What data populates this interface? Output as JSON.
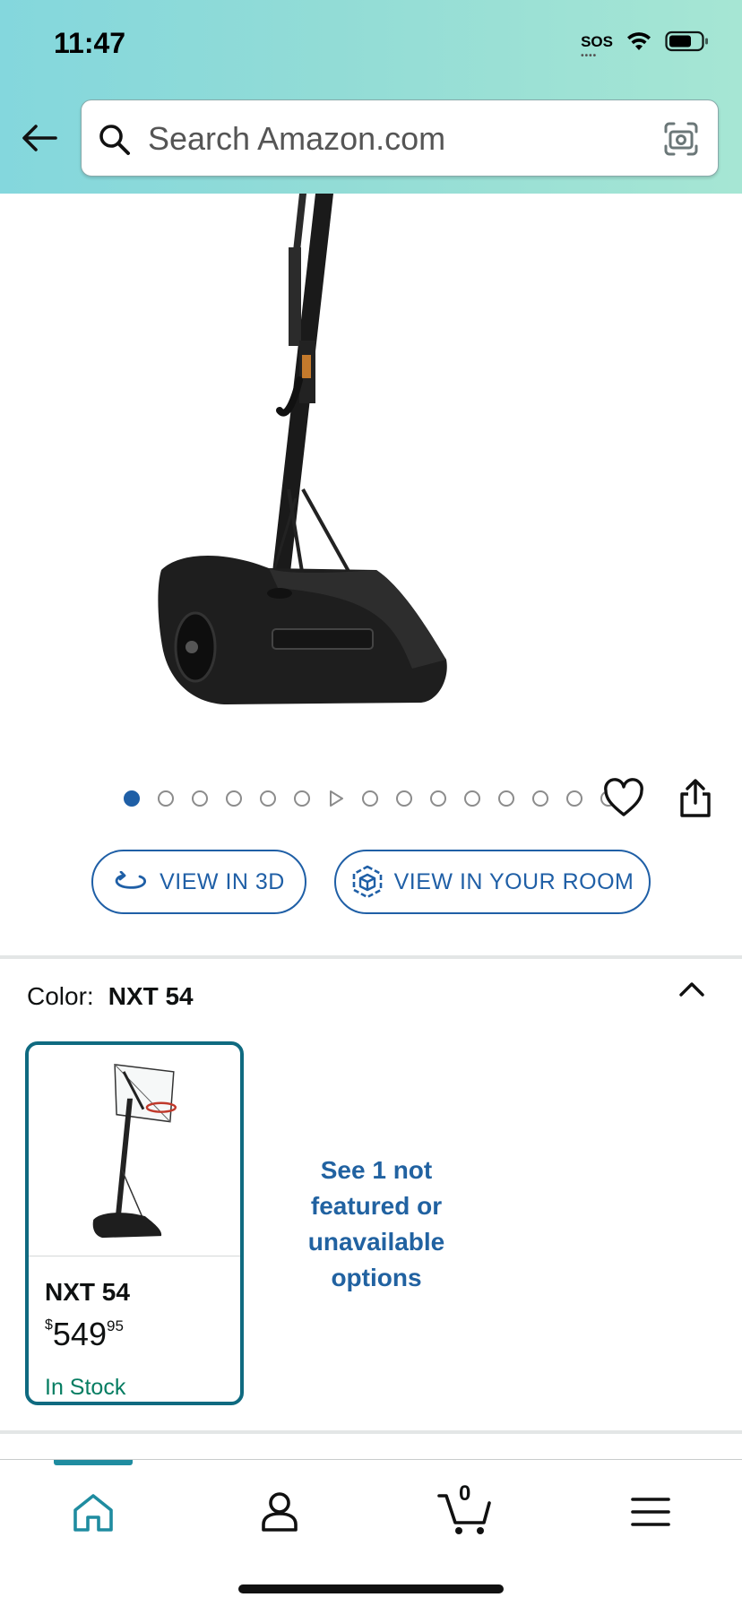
{
  "status_bar": {
    "time": "11:47",
    "sos": "SOS"
  },
  "search": {
    "placeholder": "Search Amazon.com"
  },
  "carousel": {
    "total_dots": 15,
    "active_index": 0,
    "video_index": 6
  },
  "view_buttons": {
    "view_3d": "VIEW IN 3D",
    "view_room": "VIEW IN YOUR ROOM"
  },
  "color": {
    "label": "Color:",
    "selected": "NXT 54",
    "options": [
      {
        "name": "NXT 54",
        "price_symbol": "$",
        "price_whole": "549",
        "price_fraction": "95",
        "availability": "In Stock"
      }
    ],
    "see_more": "See 1 not featured or unavailable options"
  },
  "bottom_nav": {
    "cart_count": "0",
    "active": "home"
  },
  "colors": {
    "header_start": "#84d7dd",
    "header_end": "#a6e6d4",
    "link_blue": "#1f5fa6",
    "selected_border": "#0f6a80",
    "in_stock_green": "#067d62"
  }
}
